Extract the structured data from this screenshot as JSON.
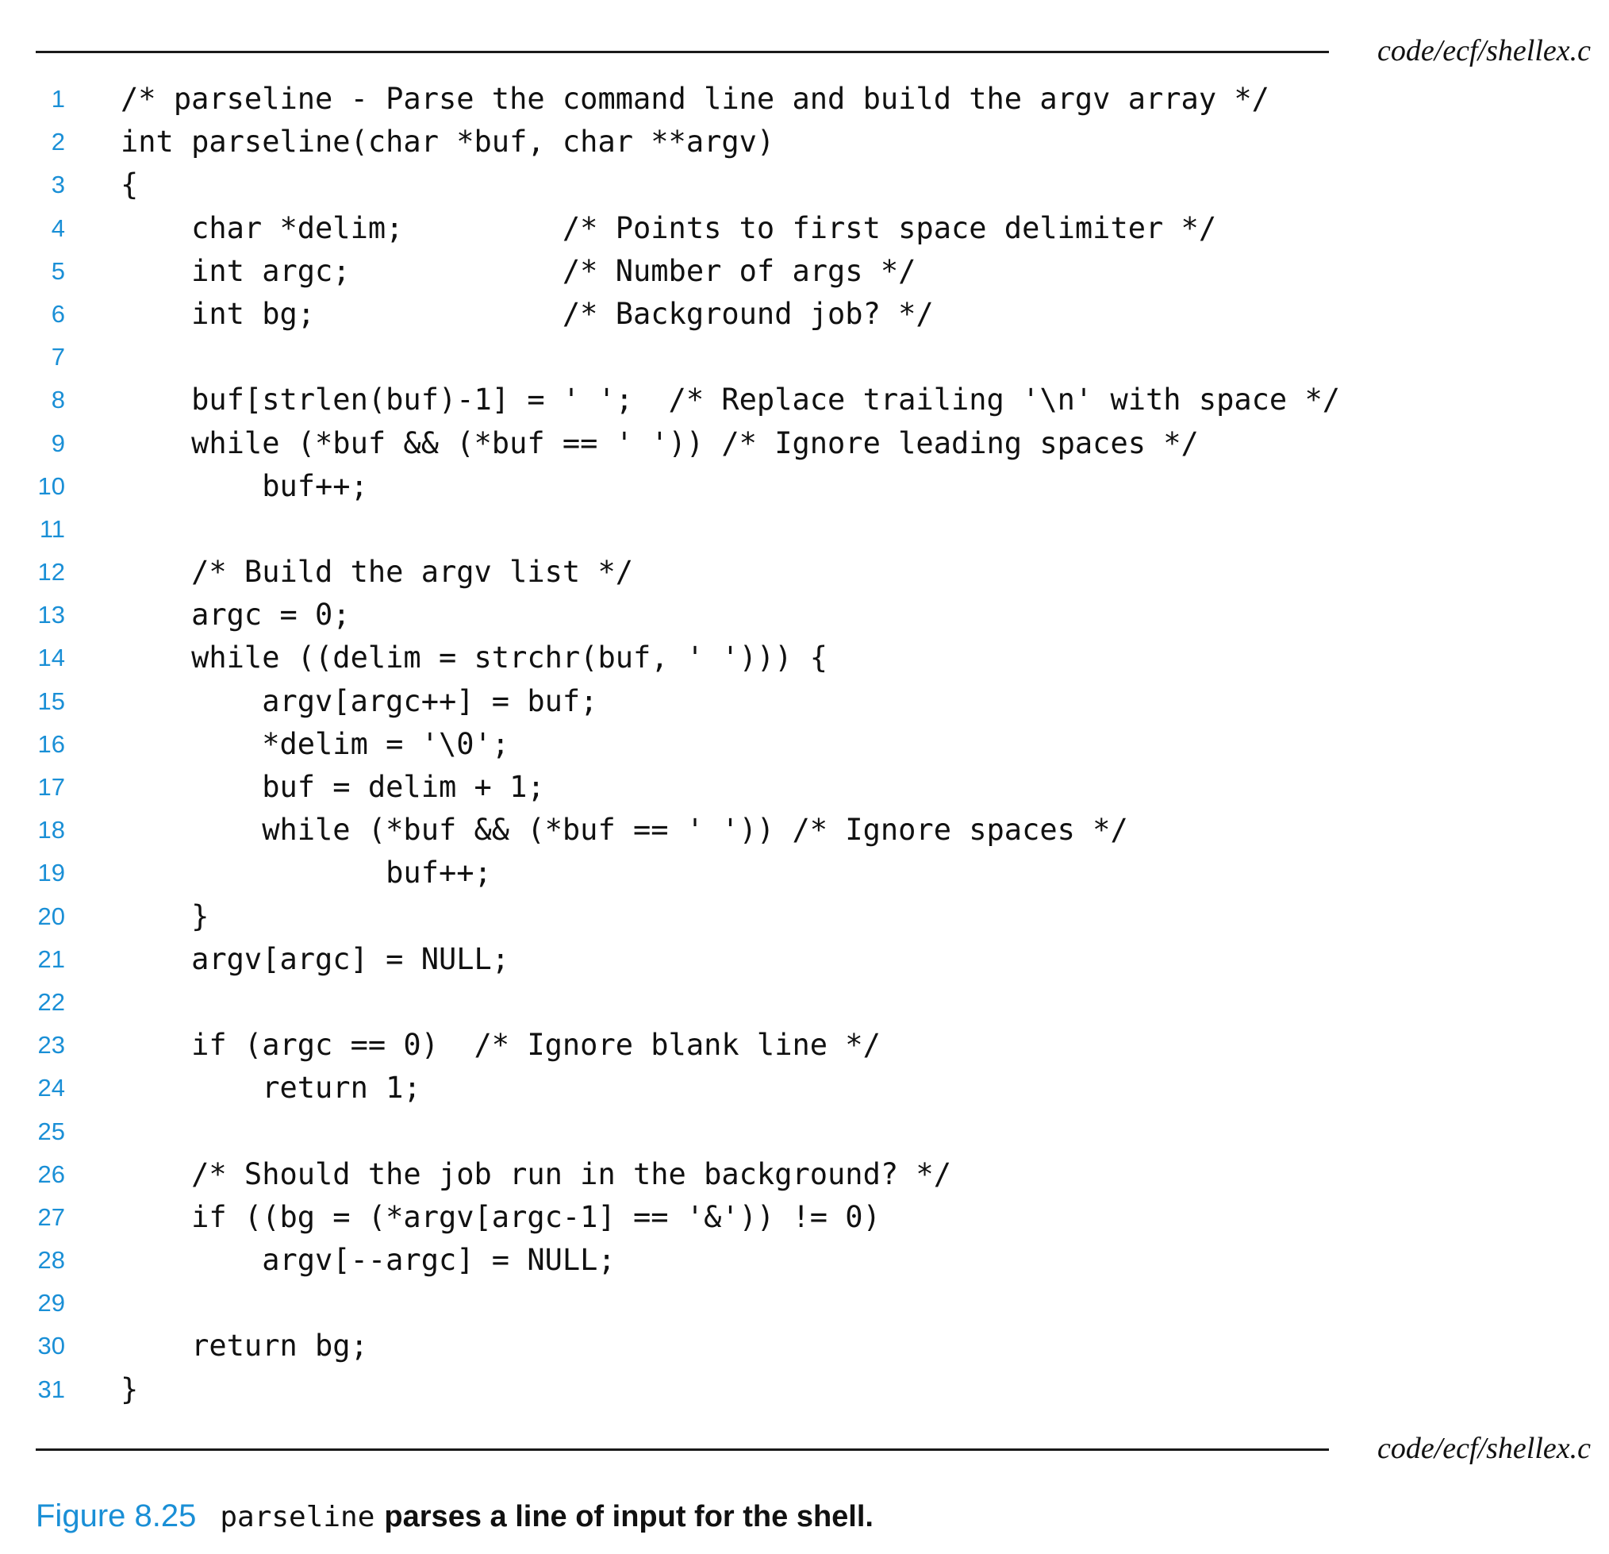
{
  "header": {
    "filename": "code/ecf/shellex.c"
  },
  "footer": {
    "filename": "code/ecf/shellex.c"
  },
  "code": {
    "lines": [
      {
        "number": "1",
        "text": "/* parseline - Parse the command line and build the argv array */"
      },
      {
        "number": "2",
        "text": "int parseline(char *buf, char **argv)"
      },
      {
        "number": "3",
        "text": "{"
      },
      {
        "number": "4",
        "text": "    char *delim;         /* Points to first space delimiter */"
      },
      {
        "number": "5",
        "text": "    int argc;            /* Number of args */"
      },
      {
        "number": "6",
        "text": "    int bg;              /* Background job? */"
      },
      {
        "number": "7",
        "text": ""
      },
      {
        "number": "8",
        "text": "    buf[strlen(buf)-1] = ' ';  /* Replace trailing '\\n' with space */"
      },
      {
        "number": "9",
        "text": "    while (*buf && (*buf == ' ')) /* Ignore leading spaces */"
      },
      {
        "number": "10",
        "text": "        buf++;"
      },
      {
        "number": "11",
        "text": ""
      },
      {
        "number": "12",
        "text": "    /* Build the argv list */"
      },
      {
        "number": "13",
        "text": "    argc = 0;"
      },
      {
        "number": "14",
        "text": "    while ((delim = strchr(buf, ' '))) {"
      },
      {
        "number": "15",
        "text": "        argv[argc++] = buf;"
      },
      {
        "number": "16",
        "text": "        *delim = '\\0';"
      },
      {
        "number": "17",
        "text": "        buf = delim + 1;"
      },
      {
        "number": "18",
        "text": "        while (*buf && (*buf == ' ')) /* Ignore spaces */"
      },
      {
        "number": "19",
        "text": "               buf++;"
      },
      {
        "number": "20",
        "text": "    }"
      },
      {
        "number": "21",
        "text": "    argv[argc] = NULL;"
      },
      {
        "number": "22",
        "text": ""
      },
      {
        "number": "23",
        "text": "    if (argc == 0)  /* Ignore blank line */"
      },
      {
        "number": "24",
        "text": "        return 1;"
      },
      {
        "number": "25",
        "text": ""
      },
      {
        "number": "26",
        "text": "    /* Should the job run in the background? */"
      },
      {
        "number": "27",
        "text": "    if ((bg = (*argv[argc-1] == '&')) != 0)"
      },
      {
        "number": "28",
        "text": "        argv[--argc] = NULL;"
      },
      {
        "number": "29",
        "text": ""
      },
      {
        "number": "30",
        "text": "    return bg;"
      },
      {
        "number": "31",
        "text": "}"
      }
    ]
  },
  "caption": {
    "label": "Figure 8.25",
    "code": "parseline",
    "text": "parses a line of input for the shell."
  },
  "colors": {
    "accent": "#1a8fd6",
    "text": "#111111",
    "background": "#ffffff"
  }
}
